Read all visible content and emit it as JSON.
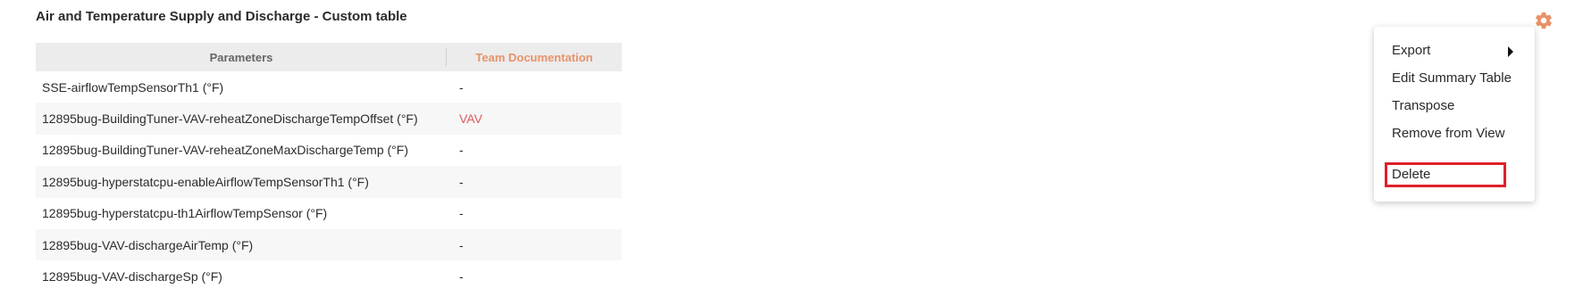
{
  "widget": {
    "title": "Air and Temperature Supply and Discharge - Custom table"
  },
  "table": {
    "headers": {
      "parameters": "Parameters",
      "team_documentation": "Team Documentation"
    },
    "rows": [
      {
        "parameter": "SSE-airflowTempSensorTh1  (°F)",
        "doc": "-"
      },
      {
        "parameter": "12895bug-BuildingTuner-VAV-reheatZoneDischargeTempOffset  (°F)",
        "doc": "VAV"
      },
      {
        "parameter": "12895bug-BuildingTuner-VAV-reheatZoneMaxDischargeTemp  (°F)",
        "doc": "-"
      },
      {
        "parameter": "12895bug-hyperstatcpu-enableAirflowTempSensorTh1  (°F)",
        "doc": "-"
      },
      {
        "parameter": "12895bug-hyperstatcpu-th1AirflowTempSensor  (°F)",
        "doc": "-"
      },
      {
        "parameter": "12895bug-VAV-dischargeAirTemp  (°F)",
        "doc": "-"
      },
      {
        "parameter": "12895bug-VAV-dischargeSp  (°F)",
        "doc": "-"
      }
    ]
  },
  "settings": {
    "icon": "gear-icon",
    "color": "#e8926a"
  },
  "context_menu": {
    "items": [
      {
        "label": "Export",
        "has_submenu": true
      },
      {
        "label": "Edit Summary Table"
      },
      {
        "label": "Transpose"
      },
      {
        "label": "Remove from View"
      },
      {
        "label": "Delete",
        "highlighted": true
      }
    ],
    "highlight_color": "#e0202a"
  }
}
